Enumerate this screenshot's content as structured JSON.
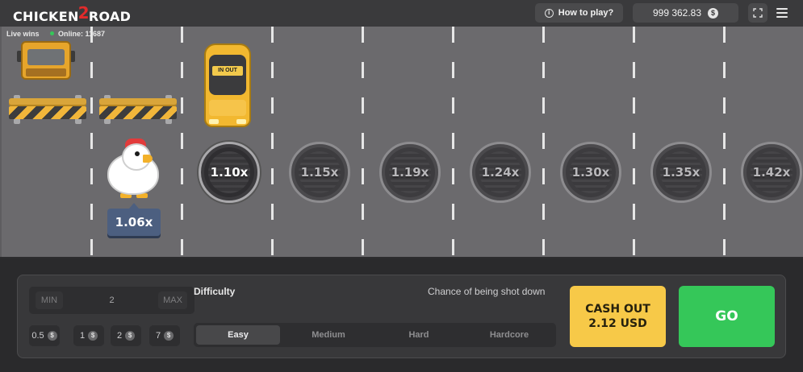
{
  "header": {
    "logo_left": "CHICKEN",
    "logo_mid": "2",
    "logo_right": "ROAD",
    "live_wins": "Live wins",
    "online": "Online: 11687",
    "how_to_play": "How to play?",
    "balance": "999 362.83",
    "currency_symbol": "$"
  },
  "road": {
    "multipliers": [
      "1.10x",
      "1.15x",
      "1.19x",
      "1.24x",
      "1.30x",
      "1.35x",
      "1.42x"
    ],
    "current_multiplier": "1.06x",
    "car_sign": "IN OUT"
  },
  "panel": {
    "bet_min": "MIN",
    "bet_value": "2",
    "bet_max": "MAX",
    "quick_bets": [
      "0.5",
      "1",
      "2",
      "7"
    ],
    "difficulty_label": "Difficulty",
    "chance_label": "Chance of being shot down",
    "difficulties": [
      "Easy",
      "Medium",
      "Hard",
      "Hardcore"
    ],
    "selected_difficulty": "Easy",
    "cashout_line1": "CASH OUT",
    "cashout_line2": "2.12 USD",
    "go": "GO"
  },
  "colors": {
    "go": "#35c759",
    "cashout": "#f7c948",
    "badge": "#4c5f80",
    "road": "#6b6a6d"
  }
}
